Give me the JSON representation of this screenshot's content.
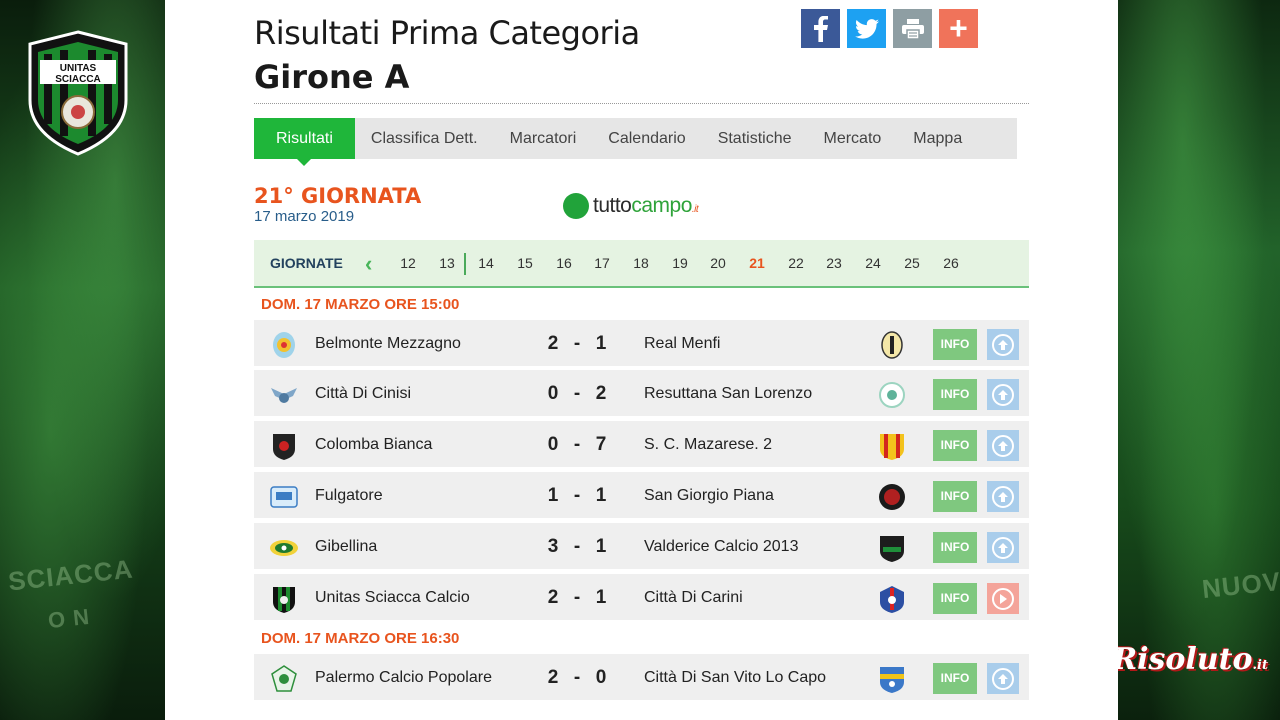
{
  "page": {
    "title_line1": "Risultati Prima Categoria",
    "title_line2": "Girone A"
  },
  "club_logo": {
    "text_top": "UNITAS",
    "text_bottom": "SCIACCA"
  },
  "watermark": {
    "text": "Risoluto",
    "suffix": ".it"
  },
  "side_texts": {
    "left_a": "SCIACCA",
    "left_b": "O N",
    "right_a": "NUOV"
  },
  "share": {
    "facebook": "f",
    "twitter": "t",
    "print": "p",
    "more": "+"
  },
  "tabs": [
    {
      "label": "Risultati",
      "active": true
    },
    {
      "label": "Classifica Dett.",
      "active": false
    },
    {
      "label": "Marcatori",
      "active": false
    },
    {
      "label": "Calendario",
      "active": false
    },
    {
      "label": "Statistiche",
      "active": false
    },
    {
      "label": "Mercato",
      "active": false
    },
    {
      "label": "Mappa",
      "active": false
    }
  ],
  "round": {
    "title": "21° GIORNATA",
    "date": "17 marzo 2019"
  },
  "brand": {
    "part1": "tutto",
    "part2": "campo",
    "part3": ".it"
  },
  "giornate": {
    "label": "GIORNATE",
    "numbers": [
      "12",
      "13",
      "14",
      "15",
      "16",
      "17",
      "18",
      "19",
      "20",
      "21",
      "22",
      "23",
      "24",
      "25",
      "26"
    ],
    "active": "21"
  },
  "sections": [
    {
      "title": "DOM. 17 MARZO ORE 15:00"
    },
    {
      "title": "DOM. 17 MARZO ORE 16:30"
    }
  ],
  "matches": [
    {
      "home": "Belmonte Mezzagno",
      "home_score": "2",
      "away_score": "1",
      "away": "Real Menfi",
      "info": "INFO",
      "action": "up-arrow-icon"
    },
    {
      "home": "Città Di Cinisi",
      "home_score": "0",
      "away_score": "2",
      "away": "Resuttana San Lorenzo",
      "info": "INFO",
      "action": "up-arrow-icon"
    },
    {
      "home": "Colomba Bianca",
      "home_score": "0",
      "away_score": "7",
      "away": "S. C. Mazarese. 2",
      "info": "INFO",
      "action": "up-arrow-icon"
    },
    {
      "home": "Fulgatore",
      "home_score": "1",
      "away_score": "1",
      "away": "San Giorgio Piana",
      "info": "INFO",
      "action": "up-arrow-icon"
    },
    {
      "home": "Gibellina",
      "home_score": "3",
      "away_score": "1",
      "away": "Valderice Calcio 2013",
      "info": "INFO",
      "action": "up-arrow-icon"
    },
    {
      "home": "Unitas Sciacca Calcio",
      "home_score": "2",
      "away_score": "1",
      "away": "Città Di Carini",
      "info": "INFO",
      "action": "play-icon"
    },
    {
      "home": "Palermo Calcio Popolare",
      "home_score": "2",
      "away_score": "0",
      "away": "Città Di San Vito Lo Capo",
      "info": "INFO",
      "action": "up-arrow-icon"
    }
  ],
  "score_separator": "-",
  "colors": {
    "accent_green": "#1fb63a",
    "accent_orange": "#e8541e",
    "date_blue": "#285d8a",
    "info_green": "#7fc87f",
    "action_blue": "#a9cdeb",
    "action_red": "#f4a49a"
  }
}
